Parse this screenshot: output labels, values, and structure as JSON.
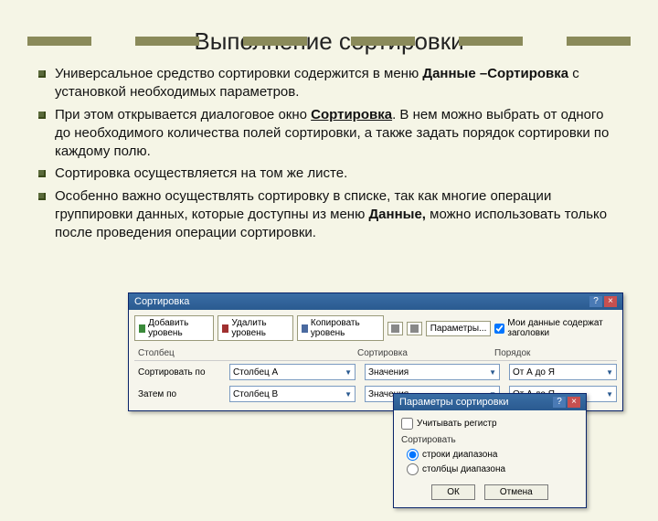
{
  "decor": true,
  "title": "Выполнение сортировки",
  "bullets": [
    {
      "pre": "Универсальное средство сортировки содержится в меню ",
      "b1": "Данные –Сортировка",
      "post": " с установкой необходимых параметров."
    },
    {
      "pre": "При этом открывается диалоговое окно ",
      "b1": "Сортировка",
      "post": ". В нем можно выбрать от одного до необходимого количества полей сортировки, а также задать порядок сортировки по каждому полю."
    },
    {
      "pre": "Сортировка осуществляется на том же листе.",
      "b1": "",
      "post": ""
    },
    {
      "pre": "Особенно важно осуществлять сортировку в списке, так как многие операции группировки данных, которые доступны из меню ",
      "b1": "Данные,",
      "post": " можно использовать только после проведения операции сортировки."
    }
  ],
  "sortDialog": {
    "title": "Сортировка",
    "toolbar": {
      "add": "Добавить уровень",
      "del": "Удалить уровень",
      "copy": "Копировать уровень",
      "params": "Параметры...",
      "headers_chk": "Мои данные содержат заголовки"
    },
    "headers": {
      "col": "Столбец",
      "sort": "Сортировка",
      "order": "Порядок"
    },
    "rows": [
      {
        "label": "Сортировать по",
        "column": "Столбец A",
        "sort": "Значения",
        "order": "От А до Я"
      },
      {
        "label": "Затем по",
        "column": "Столбец B",
        "sort": "Значения",
        "order": "От А до Я"
      }
    ]
  },
  "paramDialog": {
    "title": "Параметры сортировки",
    "case": "Учитывать регистр",
    "groupLabel": "Сортировать",
    "opt1": "строки диапазона",
    "opt2": "столбцы диапазона",
    "ok": "ОК",
    "cancel": "Отмена"
  }
}
